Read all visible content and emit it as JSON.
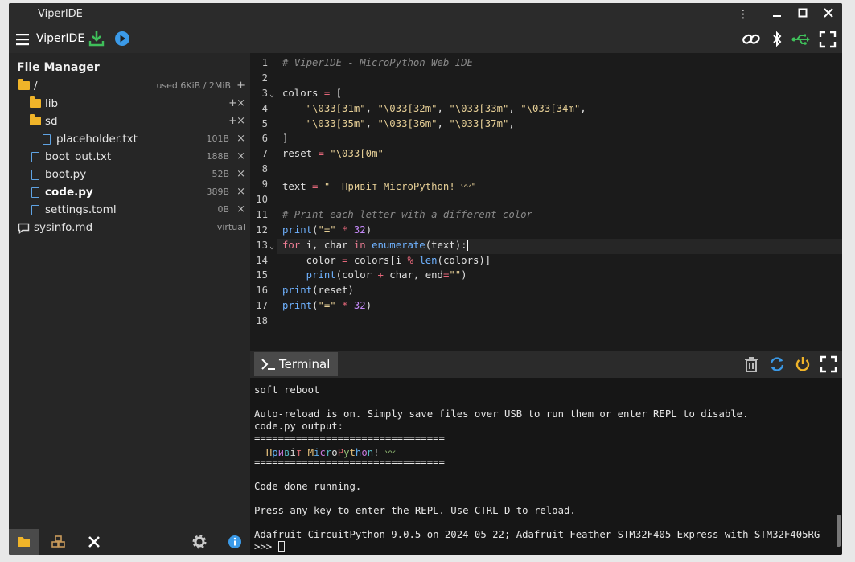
{
  "window": {
    "title": "ViperIDE"
  },
  "toolbar": {
    "app_name": "ViperIDE"
  },
  "file_manager": {
    "title": "File Manager",
    "root": {
      "name": "/",
      "info": "used 6KiB / 2MiB"
    },
    "items": [
      {
        "name": "lib",
        "type": "folder"
      },
      {
        "name": "sd",
        "type": "folder"
      },
      {
        "name": "placeholder.txt",
        "size": "101B"
      },
      {
        "name": "boot_out.txt",
        "size": "188B"
      },
      {
        "name": "boot.py",
        "size": "52B"
      },
      {
        "name": "code.py",
        "size": "389B"
      },
      {
        "name": "settings.toml",
        "size": "0B"
      },
      {
        "name": "sysinfo.md",
        "size": "virtual"
      }
    ]
  },
  "editor": {
    "line_numbers": [
      "1",
      "2",
      "3",
      "4",
      "5",
      "6",
      "7",
      "8",
      "9",
      "10",
      "11",
      "12",
      "13",
      "14",
      "15",
      "16",
      "17",
      "18"
    ]
  },
  "terminal": {
    "tab_label": "Terminal",
    "lines": [
      "soft reboot",
      "",
      "Auto-reload is on. Simply save files over USB to run them or enter REPL to disable.",
      "code.py output:",
      "================================",
      "  Привіт MicroPython! 〰",
      "================================",
      "",
      "Code done running.",
      "",
      "Press any key to enter the REPL. Use CTRL-D to reload.",
      "",
      "Adafruit CircuitPython 9.0.5 on 2024-05-22; Adafruit Feather STM32F405 Express with STM32F405RG",
      ">>> "
    ]
  },
  "colors": {
    "accent_green": "#3fbf5a",
    "accent_blue": "#3b9ae8",
    "power": "#f0b429"
  }
}
